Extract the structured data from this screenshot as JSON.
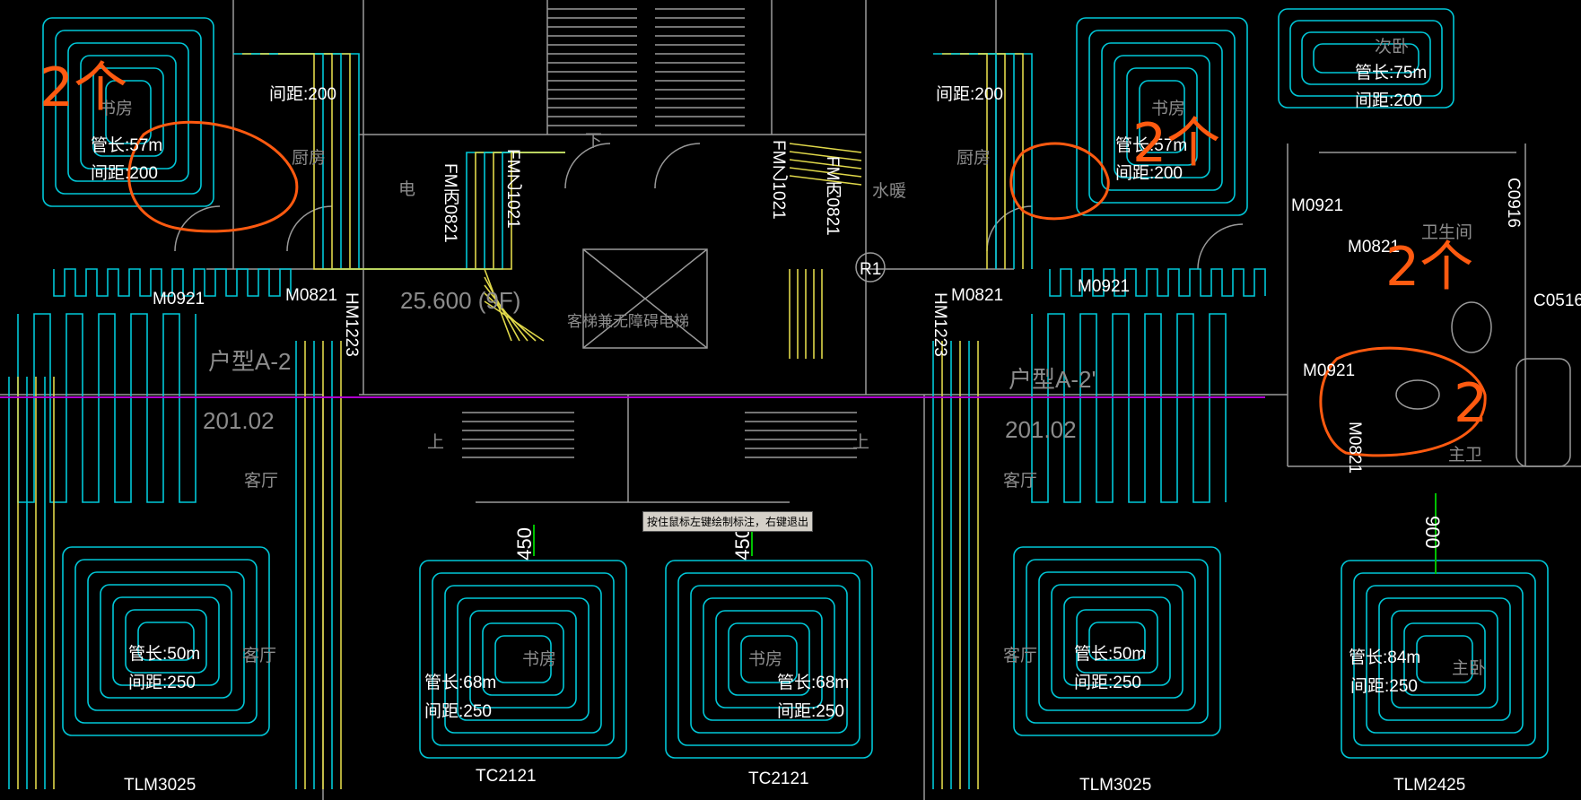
{
  "colors": {
    "background": "#000000",
    "heating_pipe_cyan": "#00c8d8",
    "heating_pipe_yellow": "#e0d84a",
    "wall": "#9a9a9a",
    "axis_line": "#b000d0",
    "markup": "#ff5a10",
    "dimension": "#00c000"
  },
  "rooms": {
    "study_left": {
      "name": "书房",
      "pipe_length": "管长:57m",
      "spacing": "间距:200"
    },
    "kitchen_left": {
      "name": "厨房",
      "spacing": "间距:200"
    },
    "kitchen_right": {
      "name": "厨房",
      "spacing": "间距:200"
    },
    "study_right": {
      "name": "书房",
      "pipe_length": "管长:57m",
      "spacing": "间距:200"
    },
    "bedroom2": {
      "name": "次卧",
      "pipe_length": "管长:75m",
      "spacing": "间距:200"
    },
    "living_left": {
      "name": "客厅",
      "name2": "客厅",
      "pipe_length": "管长:50m",
      "spacing": "间距:250"
    },
    "study_bottom_left": {
      "name": "书房",
      "pipe_length": "管长:68m",
      "spacing": "间距:250"
    },
    "study_bottom_right": {
      "name": "书房",
      "pipe_length": "管长:68m",
      "spacing": "间距:250"
    },
    "living_right": {
      "name": "客厅",
      "name2": "客厅",
      "pipe_length": "管长:50m",
      "spacing": "间距:250"
    },
    "master_bedroom": {
      "name": "主卧",
      "pipe_length": "管长:84m",
      "spacing": "间距:250"
    },
    "bathroom": {
      "name": "卫生间",
      "name2": "主卫"
    },
    "electric": {
      "name": "电"
    },
    "heating": {
      "name": "水暖"
    }
  },
  "door_tags": [
    "M0921",
    "M0821",
    "M0821",
    "M0921",
    "M0921",
    "M0821",
    "M0921",
    "M0821"
  ],
  "vertical_tags": [
    "FM丙0821",
    "FM乙1021",
    "FM乙1021",
    "FM丙0821",
    "HM1223",
    "HM1223",
    "C0916"
  ],
  "window_tags": [
    "TLM3025",
    "TC2121",
    "TC2121",
    "TLM3025",
    "TLM2425",
    "C0516"
  ],
  "core": {
    "elevator": "客梯兼无障碍电梯",
    "level": "25.600 (9F)",
    "riser": "R1",
    "stair_up": "上",
    "stair_down": "下",
    "stair_up2": "上"
  },
  "units": {
    "left_type": "户型A-2",
    "left_no": "201.02",
    "right_type": "户型A-2'",
    "right_no": "201.02"
  },
  "dimensions": [
    "450",
    "450",
    "900"
  ],
  "markup_notes": [
    "2个",
    "2个",
    "2个",
    "2"
  ],
  "status_tooltip": "按住鼠标左键绘制标注，右键退出"
}
